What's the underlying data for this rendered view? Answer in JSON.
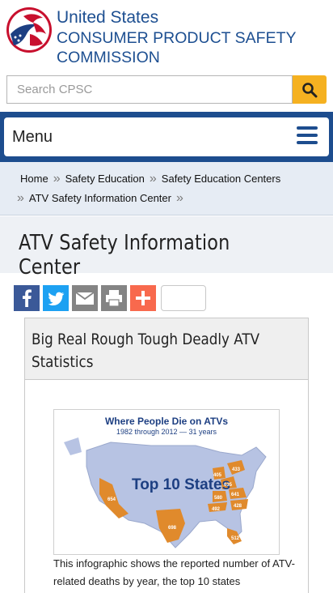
{
  "header": {
    "agency_line1": "United States",
    "agency_line2": "CONSUMER PRODUCT SAFETY",
    "agency_line3": "COMMISSION"
  },
  "search": {
    "placeholder": "Search CPSC",
    "value": ""
  },
  "menu": {
    "label": "Menu"
  },
  "breadcrumb": {
    "items": [
      "Home",
      "Safety Education",
      "Safety Education Centers",
      "ATV Safety Information Center"
    ]
  },
  "page": {
    "title": "ATV Safety Information Center"
  },
  "share": {
    "buttons": [
      "facebook-icon",
      "twitter-icon",
      "email-icon",
      "print-icon",
      "addthis-plus-icon"
    ],
    "count": ""
  },
  "card": {
    "title": "Big Real Rough Tough Deadly ATV Statistics",
    "infographic": {
      "heading": "Where People Die on ATVs",
      "subheading": "1982 through 2012 — 31 years",
      "banner": "Top 10 States",
      "state_values": [
        "654",
        "698",
        "512",
        "405",
        "433",
        "635",
        "580",
        "641",
        "428",
        "492"
      ]
    },
    "caption": "This infographic shows the reported number of ATV-related deaths by year, the top 10 states"
  },
  "colors": {
    "brand_blue": "#1d4f91",
    "search_button": "#f5b121",
    "map_orange": "#e08a2c",
    "map_blue": "#b7c3e3"
  }
}
